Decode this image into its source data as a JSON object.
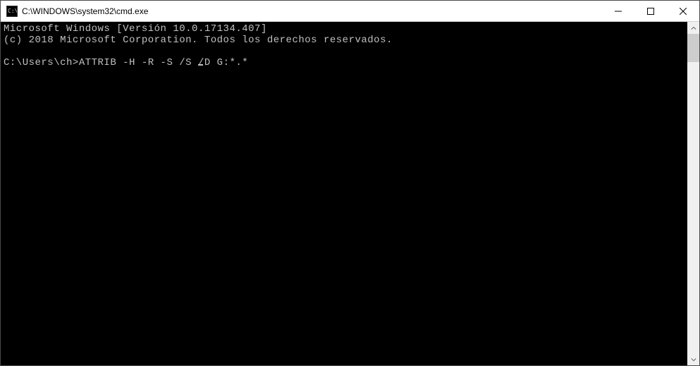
{
  "window": {
    "title": "C:\\WINDOWS\\system32\\cmd.exe",
    "icon_text": "C:\\"
  },
  "terminal": {
    "line1": "Microsoft Windows [Versión 10.0.17134.407]",
    "line2": "(c) 2018 Microsoft Corporation. Todos los derechos reservados.",
    "blank": "",
    "prompt": "C:\\Users\\ch>",
    "command_part1": "ATTRIB -H -R -S /S ",
    "command_part2": "/",
    "command_part3": "D G:*.*"
  }
}
